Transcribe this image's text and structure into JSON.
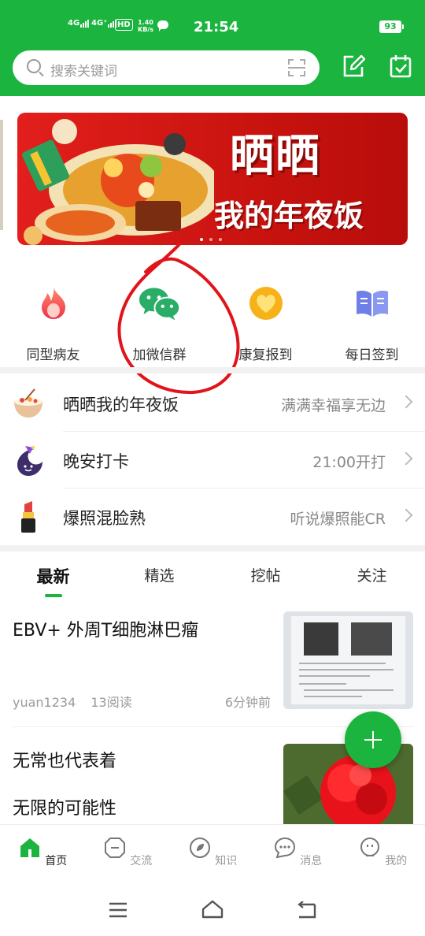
{
  "status_bar": {
    "net1": "4G",
    "net2": "4G⁺",
    "hd": "HD",
    "speed_value": "1.40",
    "speed_unit": "KB/s",
    "time": "21:54",
    "battery": "93"
  },
  "header": {
    "search_placeholder": "搜索关键词",
    "icons": [
      "scan-icon",
      "edit-icon",
      "calendar-check-icon"
    ]
  },
  "banner": {
    "line1": "晒晒",
    "line2": "我的年夜饭",
    "page_count": 3,
    "active_page": 1
  },
  "quick_entries": [
    {
      "label": "同型病友",
      "icon": "flame-icon"
    },
    {
      "label": "加微信群",
      "icon": "wechat-icon"
    },
    {
      "label": "康复报到",
      "icon": "heart-icon"
    },
    {
      "label": "每日签到",
      "icon": "book-icon"
    }
  ],
  "topics": [
    {
      "title": "晒晒我的年夜饭",
      "subtitle": "满满幸福享无边",
      "icon": "bowl-icon"
    },
    {
      "title": "晚安打卡",
      "subtitle": "21:00开打",
      "icon": "moon-icon"
    },
    {
      "title": "爆照混脸熟",
      "subtitle": "听说爆照能CR",
      "icon": "lipstick-icon"
    }
  ],
  "tabs": [
    {
      "label": "最新",
      "active": true
    },
    {
      "label": "精选",
      "active": false
    },
    {
      "label": "挖帖",
      "active": false
    },
    {
      "label": "关注",
      "active": false
    }
  ],
  "posts": [
    {
      "title": "EBV+ 外周T细胞淋巴瘤",
      "author": "yuan1234",
      "reads": "13阅读",
      "time": "6分钟前"
    },
    {
      "title": "无常也代表着",
      "line2": "无限的可能性"
    }
  ],
  "bottom_nav": [
    {
      "label": "首页",
      "active": true,
      "icon": "home-icon"
    },
    {
      "label": "交流",
      "active": false,
      "icon": "exchange-icon"
    },
    {
      "label": "知识",
      "active": false,
      "icon": "knowledge-icon"
    },
    {
      "label": "消息",
      "active": false,
      "icon": "message-icon"
    },
    {
      "label": "我的",
      "active": false,
      "icon": "profile-icon"
    }
  ],
  "colors": {
    "brand": "#1ab43e",
    "annotation": "#e0141a"
  }
}
